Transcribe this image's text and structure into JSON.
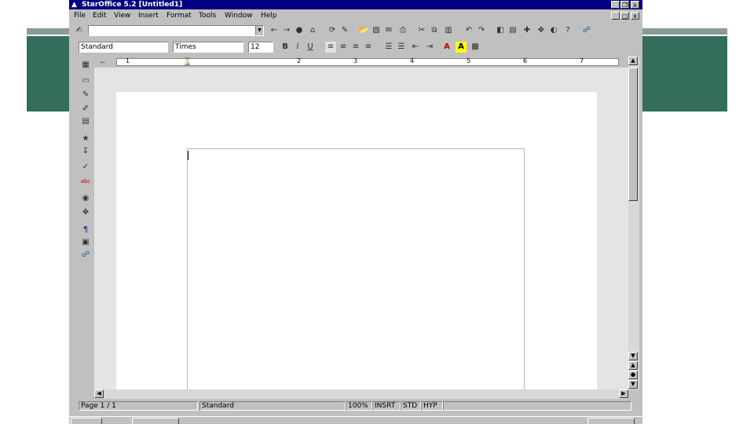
{
  "window": {
    "title": "StarOffice 5.2  [Untitled1]",
    "minimize": "_",
    "restore": "❐",
    "close": "x"
  },
  "menu": [
    "File",
    "Edit",
    "View",
    "Insert",
    "Format",
    "Tools",
    "Window",
    "Help"
  ],
  "toolbar": {
    "url_value": "",
    "style_value": "Standard",
    "font_value": "Times",
    "size_value": "12"
  },
  "status": {
    "page": "Page 1 / 1",
    "style": "Standard",
    "zoom": "100%",
    "insert": "INSRT",
    "std": "STD",
    "hyp": "HYP"
  },
  "ruler_numbers": [
    "1",
    "2",
    "3",
    "4",
    "5",
    "6",
    "7"
  ]
}
